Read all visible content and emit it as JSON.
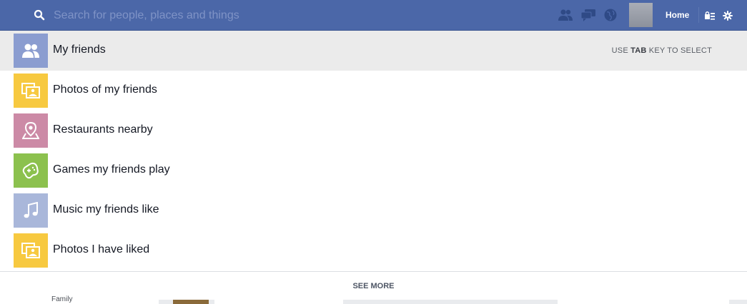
{
  "header": {
    "search": {
      "placeholder": "Search for people, places and things",
      "value": "",
      "icon": "search-icon"
    },
    "icons": [
      "friend-requests-icon",
      "messages-icon",
      "notifications-globe-icon"
    ],
    "home_label": "Home",
    "settings_icons": [
      "privacy-shortcuts-icon",
      "gear-icon"
    ],
    "colors": {
      "bar": "#4b67a8",
      "placeholder": "#7f93c6"
    }
  },
  "dropdown": {
    "hint": {
      "prefix": "USE",
      "key": "TAB",
      "suffix": "KEY TO SELECT"
    },
    "items": [
      {
        "label": "My friends",
        "icon": "friends-icon",
        "color": "#8b9dd0",
        "selected": true
      },
      {
        "label": "Photos of my friends",
        "icon": "photos-icon",
        "color": "#f7c940"
      },
      {
        "label": "Restaurants nearby",
        "icon": "map-pin-icon",
        "color": "#cc8aa6"
      },
      {
        "label": "Games my friends play",
        "icon": "game-controller-icon",
        "color": "#8cc14e"
      },
      {
        "label": "Music my friends like",
        "icon": "music-note-icon",
        "color": "#a9b7da"
      },
      {
        "label": "Photos I have liked",
        "icon": "photos-icon",
        "color": "#f7c940"
      }
    ],
    "see_more": "SEE MORE"
  },
  "background": {
    "partial_text": "Family"
  }
}
